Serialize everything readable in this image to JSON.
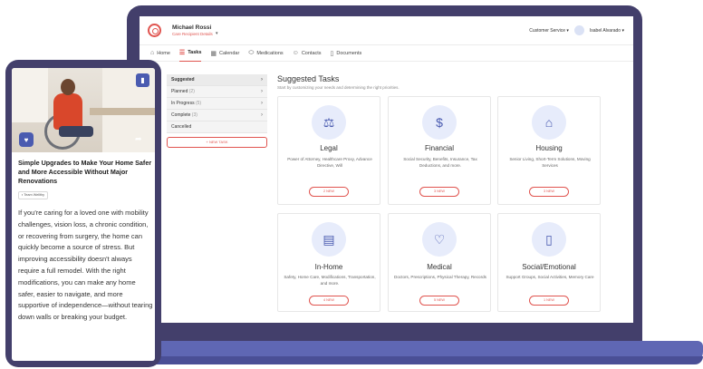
{
  "header": {
    "user_name": "Michael Rossi",
    "user_sub": "Care Recipient Details",
    "customer_service": "Customer Service",
    "account_name": "Isabel Alvarado"
  },
  "nav": {
    "items": [
      {
        "label": "Home",
        "icon": "home-icon"
      },
      {
        "label": "Tasks",
        "icon": "tasks-list-icon",
        "active": true
      },
      {
        "label": "Calendar",
        "icon": "calendar-icon"
      },
      {
        "label": "Medications",
        "icon": "pill-icon"
      },
      {
        "label": "Contacts",
        "icon": "contacts-icon"
      },
      {
        "label": "Documents",
        "icon": "document-icon"
      }
    ]
  },
  "status_list": {
    "items": [
      {
        "label": "Suggested",
        "count": ""
      },
      {
        "label": "Planned",
        "count": "(2)"
      },
      {
        "label": "In Progress",
        "count": "(5)"
      },
      {
        "label": "Complete",
        "count": "(3)"
      },
      {
        "label": "Cancelled",
        "count": ""
      }
    ],
    "new_task": "+ NEW TASK"
  },
  "main": {
    "title": "Suggested Tasks",
    "subtitle": "Start by customizing your needs and determining the right priorities."
  },
  "cards": [
    {
      "title": "Legal",
      "desc": "Power of Attorney, Healthcare Proxy, Advance Directive, Will",
      "button": "2 NEW",
      "icon": "scales-icon"
    },
    {
      "title": "Financial",
      "desc": "Social Security, Benefits, Insurance, Tax Deductions, and more.",
      "button": "3 NEW",
      "icon": "money-icon"
    },
    {
      "title": "Housing",
      "desc": "Senior Living, Short-Term Solutions, Moving Services",
      "button": "3 NEW",
      "icon": "house-icon"
    },
    {
      "title": "In-Home",
      "desc": "Safety, Home Care, Modifications, Transportation, and more.",
      "button": "4 NEW",
      "icon": "bed-icon"
    },
    {
      "title": "Medical",
      "desc": "Doctors, Prescriptions, Physical Therapy, Records",
      "button": "5 NEW",
      "icon": "heartbeat-icon"
    },
    {
      "title": "Social/Emotional",
      "desc": "Support Groups, Social Activities, Memory Care",
      "button": "1 NEW",
      "icon": "phone-icon"
    }
  ],
  "article": {
    "title": "Simple Upgrades to Make Your Home Safer and More Accessible Without Major Renovations",
    "tag": "Team Wellthy",
    "body": "If you're caring for a loved one with mobility challenges, vision loss, a chronic condition, or recovering from surgery, the home can quickly become a source of stress. But improving accessibility doesn't always require a full remodel. With the right modifications, you can make any home safer, easier to navigate, and more supportive of independence—without tearing down walls or breaking your budget."
  },
  "colors": {
    "accent": "#e0544f",
    "brand": "#4a5bb0",
    "device": "#433f6b",
    "base": "#5f67b4"
  }
}
